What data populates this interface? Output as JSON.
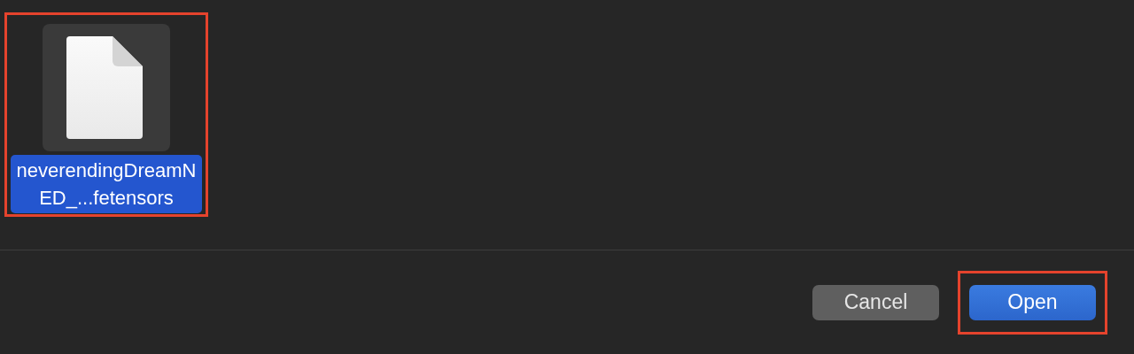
{
  "files": [
    {
      "name": "neverendingDreamNED_...fetensors",
      "selected": true,
      "highlighted": true
    }
  ],
  "buttons": [
    {
      "label": "Cancel",
      "kind": "secondary",
      "highlighted": false
    },
    {
      "label": "Open",
      "kind": "primary",
      "highlighted": true
    }
  ]
}
